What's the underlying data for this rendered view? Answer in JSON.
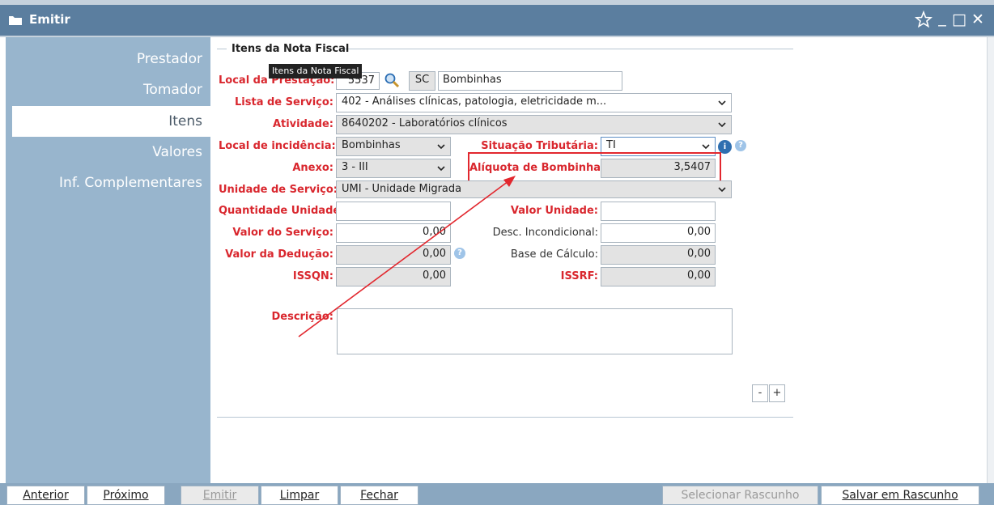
{
  "window": {
    "title": "Emitir",
    "folder_icon": "folder-icon",
    "star_icon": "star-icon",
    "minimize": "_",
    "maximize": "□",
    "close": "✕"
  },
  "sidebar": {
    "items": [
      {
        "label": "Prestador",
        "active": false
      },
      {
        "label": "Tomador",
        "active": false
      },
      {
        "label": "Itens",
        "active": true
      },
      {
        "label": "Valores",
        "active": false
      },
      {
        "label": "Inf. Complementares",
        "active": false
      }
    ]
  },
  "section": {
    "legend": "Itens da Nota Fiscal",
    "tooltip": "Itens da Nota Fiscal"
  },
  "form": {
    "local_prestacao": {
      "label": "Local da Prestação:",
      "code": "5537",
      "uf": "SC",
      "city": "Bombinhas"
    },
    "lista_servico": {
      "label": "Lista de Serviço:",
      "value": "402 - Análises clínicas, patologia, eletricidade m..."
    },
    "atividade": {
      "label": "Atividade:",
      "value": "8640202 - Laboratórios clínicos"
    },
    "local_incidencia": {
      "label": "Local de incidência:",
      "value": "Bombinhas"
    },
    "situacao_tributaria": {
      "label": "Situação Tributária:",
      "value": "TI"
    },
    "anexo": {
      "label": "Anexo:",
      "value": "3 - III"
    },
    "aliquota": {
      "label": "Alíquota de Bombinhas:",
      "value": "3,5407"
    },
    "unidade_servico": {
      "label": "Unidade de Serviço:",
      "value": "UMI - Unidade Migrada"
    },
    "quantidade_unidade": {
      "label": "Quantidade Unidade:",
      "value": ""
    },
    "valor_unidade": {
      "label": "Valor Unidade:",
      "value": ""
    },
    "valor_servico": {
      "label": "Valor do Serviço:",
      "value": "0,00"
    },
    "desc_incondicional": {
      "label": "Desc. Incondicional:",
      "value": "0,00"
    },
    "valor_deducao": {
      "label": "Valor da Dedução:",
      "value": "0,00"
    },
    "base_calculo": {
      "label": "Base de Cálculo:",
      "value": "0,00"
    },
    "issqn": {
      "label": "ISSQN:",
      "value": "0,00"
    },
    "issrf": {
      "label": "ISSRF:",
      "value": "0,00"
    },
    "descricao": {
      "label": "Descrição:",
      "value": ""
    },
    "minus": "-",
    "plus": "+"
  },
  "footer": {
    "anterior": "Anterior",
    "proximo": "Próximo",
    "emitir": "Emitir",
    "limpar": "Limpar",
    "fechar": "Fechar",
    "selecionar_rascunho": "Selecionar Rascunho",
    "salvar_rascunho": "Salvar em Rascunho"
  },
  "colors": {
    "title_bar": "#5b7e9f",
    "sidebar": "#98b5cd",
    "required_label": "#d9272e",
    "highlight": "#e2272e"
  }
}
